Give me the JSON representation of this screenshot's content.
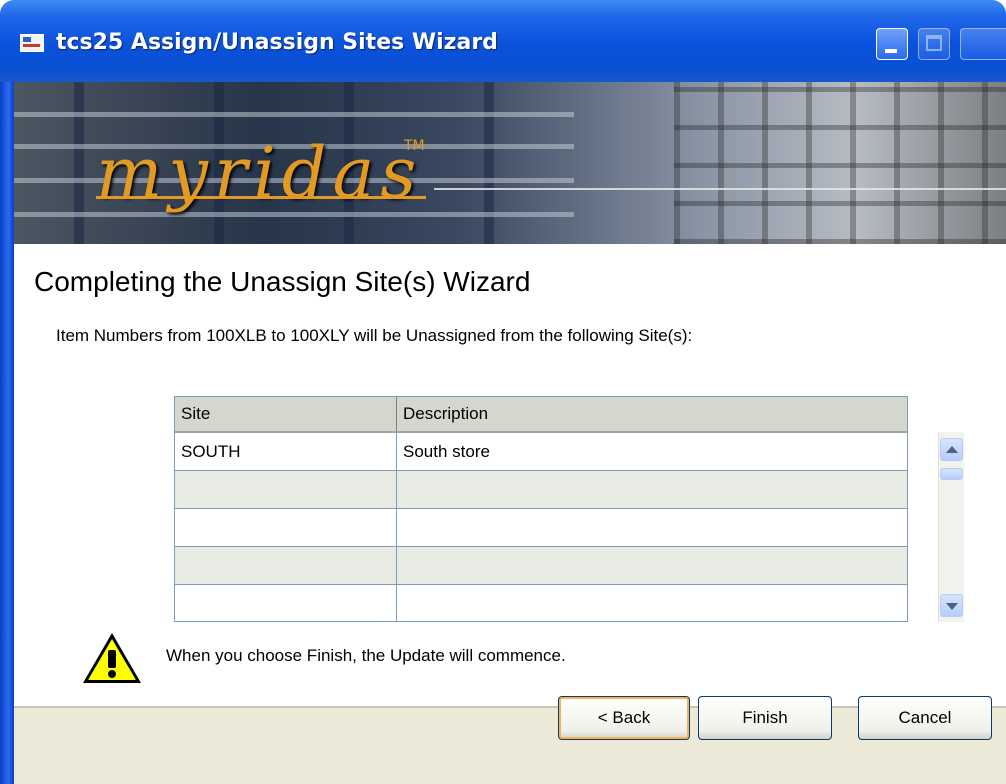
{
  "window": {
    "title": "tcs25 Assign/Unassign Sites Wizard"
  },
  "banner": {
    "logo_text": "myridas",
    "trademark": "TM"
  },
  "page": {
    "heading": "Completing the Unassign Site(s) Wizard",
    "subtext": "Item Numbers from 100XLB to 100XLY will be Unassigned from the following Site(s):"
  },
  "grid": {
    "columns": [
      "Site",
      "Description"
    ],
    "rows": [
      {
        "site": "SOUTH",
        "description": "South store"
      },
      {
        "site": "",
        "description": ""
      },
      {
        "site": "",
        "description": ""
      },
      {
        "site": "",
        "description": ""
      },
      {
        "site": "",
        "description": ""
      }
    ]
  },
  "warning": {
    "icon": "warning-exclamation-icon",
    "text": "When you choose Finish, the Update will commence."
  },
  "buttons": {
    "back": "< Back",
    "finish": "Finish",
    "cancel": "Cancel"
  },
  "colors": {
    "titlebar": "#0a52db",
    "logo": "#e39a23",
    "dialog_bg": "#ece9d8",
    "grid_header": "#d4d8cc",
    "grid_shaded_row": "#e8ebe4",
    "default_button_focus": "#f8b34a"
  }
}
